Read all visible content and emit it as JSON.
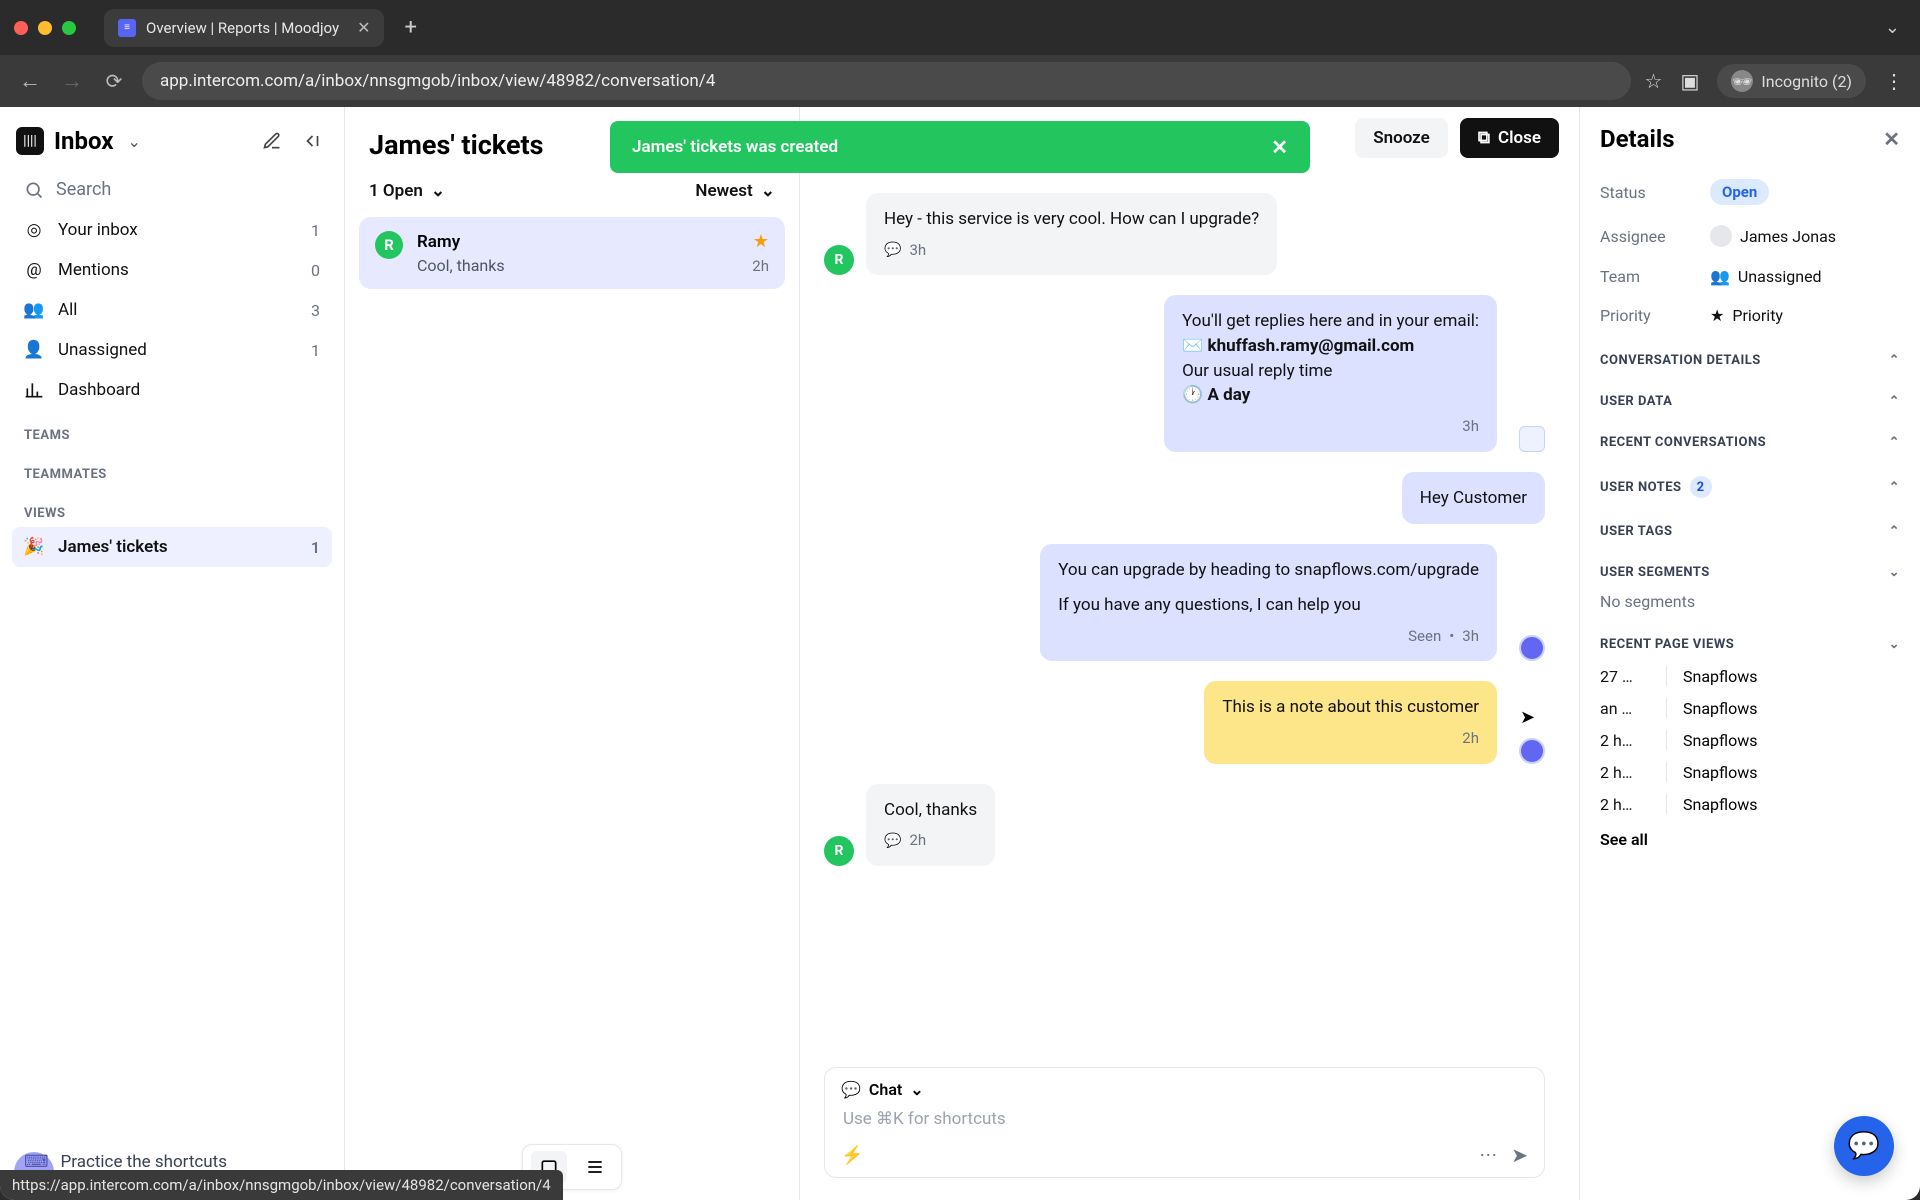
{
  "browser": {
    "tab_title": "Overview | Reports | Moodjoy",
    "url": "app.intercom.com/a/inbox/nnsgmgob/inbox/view/48982/conversation/4",
    "incognito_label": "Incognito (2)",
    "hover_url": "https://app.intercom.com/a/inbox/nnsgmgob/inbox/view/48982/conversation/4"
  },
  "sidebar": {
    "title": "Inbox",
    "search": "Search",
    "items": [
      {
        "label": "Your inbox",
        "count": "1"
      },
      {
        "label": "Mentions",
        "count": "0"
      },
      {
        "label": "All",
        "count": "3"
      },
      {
        "label": "Unassigned",
        "count": "1"
      },
      {
        "label": "Dashboard",
        "count": ""
      }
    ],
    "sections": {
      "teams": "TEAMS",
      "teammates": "TEAMMATES",
      "views": "VIEWS"
    },
    "views": [
      {
        "label": "James' tickets",
        "count": "1"
      }
    ],
    "practice": "Practice the shortcuts"
  },
  "convlist": {
    "title": "James' tickets",
    "filter_left": "1 Open",
    "filter_right": "Newest",
    "items": [
      {
        "initial": "R",
        "name": "Ramy",
        "preview": "Cool, thanks",
        "time": "2h",
        "starred": true
      }
    ]
  },
  "toolbar": {
    "snooze": "Snooze",
    "close": "Close"
  },
  "toast": {
    "text": "James' tickets was created"
  },
  "thread": {
    "m1": {
      "text": "Hey - this service is very cool. How can I upgrade?",
      "time": "3h",
      "initial": "R"
    },
    "m2": {
      "line1": "You'll get replies here and in your email:",
      "email": "khuffash.ramy@gmail.com",
      "line2": "Our usual reply time",
      "line3": "A day",
      "time": "3h"
    },
    "m3": {
      "text": "Hey Customer"
    },
    "m4": {
      "line1": "You can upgrade by heading to snapflows.com/upgrade",
      "line2": "If you have any questions, I can help you",
      "status": "Seen",
      "dot": "•",
      "time": "3h"
    },
    "m5": {
      "text": "This is a note about this customer",
      "time": "2h"
    },
    "m6": {
      "text": "Cool, thanks",
      "time": "2h",
      "initial": "R"
    }
  },
  "composer": {
    "mode": "Chat",
    "placeholder": "Use ⌘K for shortcuts"
  },
  "details": {
    "title": "Details",
    "status_k": "Status",
    "status_v": "Open",
    "assignee_k": "Assignee",
    "assignee_v": "James Jonas",
    "team_k": "Team",
    "team_v": "Unassigned",
    "priority_k": "Priority",
    "priority_v": "Priority",
    "sections": {
      "convo": "CONVERSATION DETAILS",
      "userdata": "USER DATA",
      "recent": "RECENT CONVERSATIONS",
      "notes": "USER NOTES",
      "notes_count": "2",
      "tags": "USER TAGS",
      "segments": "USER SEGMENTS",
      "no_segments": "No segments",
      "pageviews": "RECENT PAGE VIEWS"
    },
    "pageviews": [
      {
        "t": "27 …",
        "p": "Snapflows"
      },
      {
        "t": "an …",
        "p": "Snapflows"
      },
      {
        "t": "2 h…",
        "p": "Snapflows"
      },
      {
        "t": "2 h…",
        "p": "Snapflows"
      },
      {
        "t": "2 h…",
        "p": "Snapflows"
      }
    ],
    "seeall": "See all"
  }
}
